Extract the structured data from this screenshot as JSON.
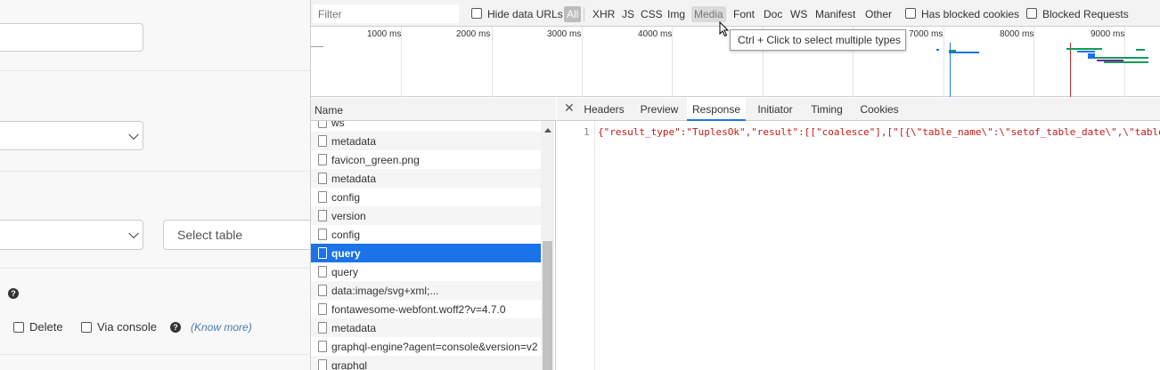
{
  "left_page": {
    "select_table_placeholder": "Select table",
    "delete_label": "Delete",
    "via_console_label": "Via console",
    "know_more_label": "(Know more)",
    "help_icon": "question-circle-icon"
  },
  "filter_bar": {
    "filter_placeholder": "Filter",
    "hide_data_urls": "Hide data URLs",
    "types": [
      "All",
      "XHR",
      "JS",
      "CSS",
      "Img",
      "Media",
      "Font",
      "Doc",
      "WS",
      "Manifest",
      "Other"
    ],
    "active_type": "All",
    "hovered_type": "Media",
    "has_blocked_cookies": "Has blocked cookies",
    "blocked_requests": "Blocked Requests"
  },
  "overview": {
    "ticks": [
      "1000 ms",
      "2000 ms",
      "3000 ms",
      "4000 ms",
      "7000 ms",
      "8000 ms",
      "9000 ms"
    ]
  },
  "tooltip": {
    "text": "Ctrl + Click to select multiple types"
  },
  "request_list": {
    "column_header": "Name",
    "rows": [
      "ws",
      "metadata",
      "favicon_green.png",
      "metadata",
      "config",
      "version",
      "config",
      "query",
      "query",
      "data:image/svg+xml;...",
      "fontawesome-webfont.woff2?v=4.7.0",
      "metadata",
      "graphql-engine?agent=console&version=v2",
      "graphql"
    ],
    "selected_index": 7
  },
  "detail": {
    "close_icon": "close-icon",
    "tabs": [
      "Headers",
      "Preview",
      "Response",
      "Initiator",
      "Timing",
      "Cookies"
    ],
    "active_tab": "Response",
    "line_number": "1",
    "response_line": "{\"result_type\":\"TuplesOk\",\"result\":[[\"coalesce\"],[\"[{\\\"table_name\\\":\\\"setof_table_date\\\",\\\"table"
  },
  "colors": {
    "selected_row": "#1a73e8",
    "string_red": "#c41a16",
    "active_tab_underline": "#1a73e8"
  }
}
